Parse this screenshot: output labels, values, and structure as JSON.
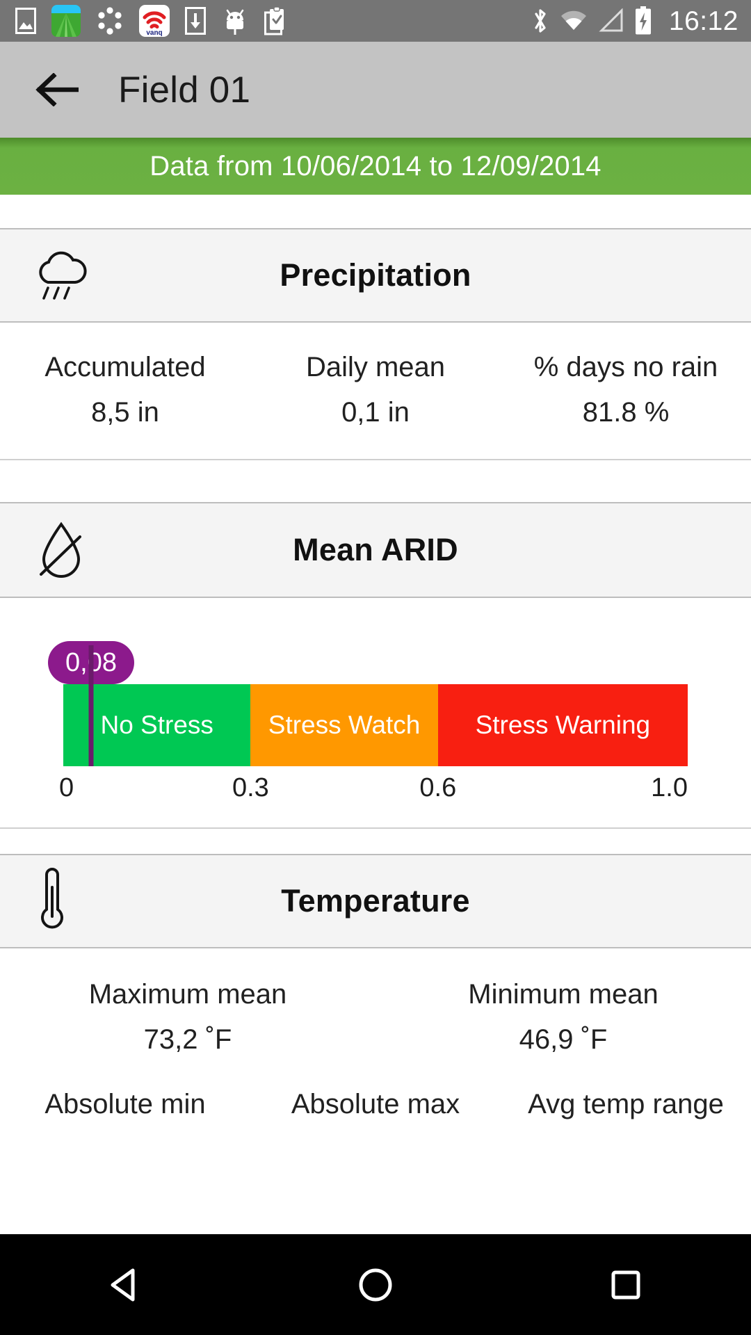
{
  "statusbar": {
    "time": "16:12",
    "left_icons": [
      "gallery-icon",
      "field-app-icon",
      "loading-dots-icon",
      "vanq-wifi-icon",
      "download-icon",
      "android-robot-icon",
      "clipboard-check-icon"
    ],
    "right_icons": [
      "bluetooth-icon",
      "wifi-icon",
      "cell-signal-icon",
      "battery-charging-icon"
    ]
  },
  "appbar": {
    "back_icon": "arrow-left-icon",
    "title": "Field 01"
  },
  "banner": {
    "text": "Data from 10/06/2014 to 12/09/2014",
    "color": "#6cb142"
  },
  "sections": {
    "precipitation": {
      "icon": "rain-cloud-icon",
      "title": "Precipitation",
      "stats": [
        {
          "label": "Accumulated",
          "value": "8,5 in"
        },
        {
          "label": "Daily mean",
          "value": "0,1 in"
        },
        {
          "label": "% days no rain",
          "value": "81.8 %"
        }
      ]
    },
    "mean_arid": {
      "icon": "no-water-drop-icon",
      "title": "Mean ARID"
    },
    "temperature": {
      "icon": "thermometer-icon",
      "title": "Temperature",
      "stats_row1": [
        {
          "label": "Maximum mean",
          "value": "73,2 ˚F"
        },
        {
          "label": "Minimum mean",
          "value": "46,9 ˚F"
        }
      ],
      "stats_row2": [
        {
          "label": "Absolute min"
        },
        {
          "label": "Absolute max"
        },
        {
          "label": "Avg temp range"
        }
      ]
    }
  },
  "chart_data": {
    "type": "bar",
    "title": "Mean ARID",
    "orientation": "horizontal-gauge",
    "value": 0.08,
    "value_label": "0,08",
    "value_color": "#8c1a8c",
    "xlim": [
      0,
      1.0
    ],
    "ticks": [
      "0",
      "0.3",
      "0.6",
      "1.0"
    ],
    "tick_values": [
      0,
      0.3,
      0.6,
      1.0
    ],
    "categories": [
      "No Stress",
      "Stress Watch",
      "Stress Warning"
    ],
    "ranges": [
      [
        0,
        0.3
      ],
      [
        0.3,
        0.6
      ],
      [
        0.6,
        1.0
      ]
    ],
    "colors": [
      "#00c853",
      "#ff9800",
      "#f81f11"
    ],
    "grid": false,
    "legend": "none"
  },
  "navbar": {
    "back": "nav-back-icon",
    "home": "nav-home-icon",
    "recents": "nav-recents-icon"
  }
}
